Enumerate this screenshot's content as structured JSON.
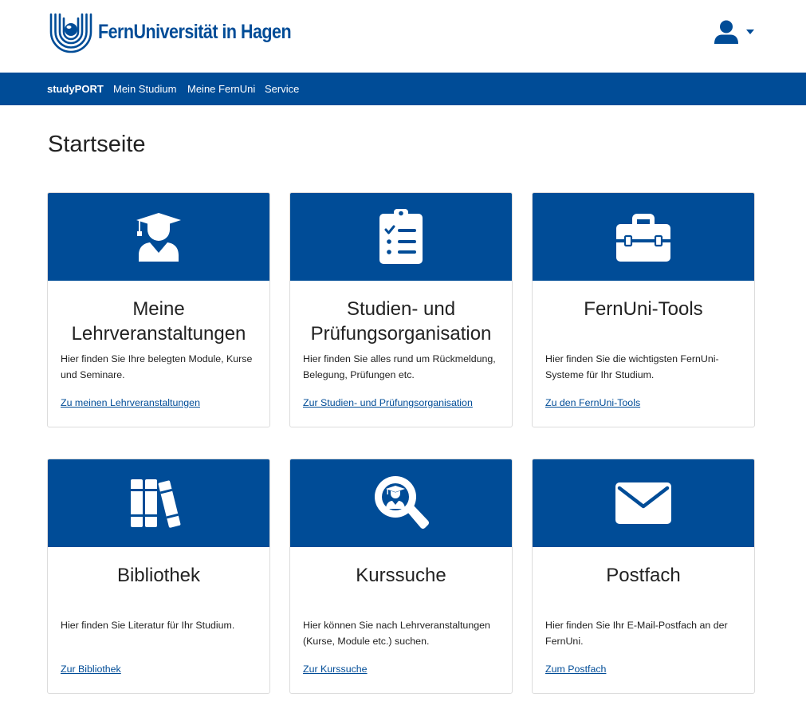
{
  "header": {
    "logo_text": "FernUniversität in Hagen",
    "user_icon": "user-icon",
    "caret_icon": "caret-down-icon"
  },
  "nav": {
    "items": [
      {
        "label": "studyPORT"
      },
      {
        "label": "Mein Studium"
      },
      {
        "label": "Meine FernUni"
      },
      {
        "label": "Service"
      }
    ]
  },
  "page": {
    "title": "Startseite"
  },
  "cards": [
    {
      "icon": "graduate-icon",
      "title": "Meine Lehrveranstaltungen",
      "text": "Hier finden Sie Ihre belegten Module, Kurse und Seminare.",
      "link": "Zu meinen Lehrveranstaltungen"
    },
    {
      "icon": "clipboard-checklist-icon",
      "title": "Studien- und Prüfungsorganisation",
      "text": "Hier finden Sie alles rund um Rück­meldung, Belegung, Prüfungen etc.",
      "link": "Zur Studien- und Prüfungsorganisation"
    },
    {
      "icon": "toolbox-icon",
      "title": "FernUni-Tools",
      "text": "Hier finden Sie die wichtigsten FernUni-Systeme für Ihr Studium.",
      "link": "Zu den FernUni-Tools"
    },
    {
      "icon": "books-icon",
      "title": "Bibliothek",
      "text": "Hier finden Sie Literatur für Ihr Studium.",
      "link": "Zur Bibliothek"
    },
    {
      "icon": "search-graduate-icon",
      "title": "Kurssuche",
      "text": "Hier können Sie nach Lehrveranstaltungen (Kurse, Module etc.) suchen.",
      "link": "Zur Kurssuche"
    },
    {
      "icon": "envelope-icon",
      "title": "Postfach",
      "text": "Hier finden Sie Ihr E-Mail-Postfach an der FernUni.",
      "link": "Zum Postfach"
    }
  ],
  "colors": {
    "brand": "#004c97",
    "background": "#ffffff",
    "text": "#212529"
  }
}
